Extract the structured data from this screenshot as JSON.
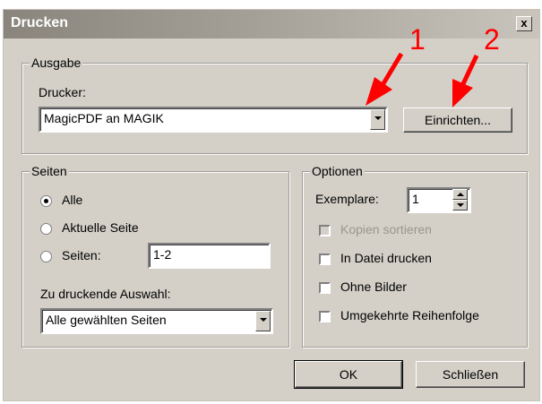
{
  "window": {
    "title": "Drucken",
    "close_label": "x"
  },
  "output_group": {
    "legend": "Ausgabe",
    "printer_label": "Drucker:",
    "printer_value": "MagicPDF an MAGIK",
    "setup_button": "Einrichten..."
  },
  "pages_group": {
    "legend": "Seiten",
    "options": [
      {
        "label": "Alle",
        "selected": true
      },
      {
        "label": "Aktuelle Seite",
        "selected": false
      },
      {
        "label": "Seiten:",
        "selected": false
      }
    ],
    "pages_value": "1-2",
    "selection_label": "Zu druckende Auswahl:",
    "selection_value": "Alle gewählten Seiten"
  },
  "options_group": {
    "legend": "Optionen",
    "copies_label": "Exemplare:",
    "copies_value": "1",
    "checkboxes": [
      {
        "label": "Kopien sortieren",
        "checked": false,
        "enabled": false
      },
      {
        "label": "In Datei drucken",
        "checked": false,
        "enabled": true
      },
      {
        "label": "Ohne Bilder",
        "checked": false,
        "enabled": true
      },
      {
        "label": "Umgekehrte Reihenfolge",
        "checked": false,
        "enabled": true
      }
    ]
  },
  "buttons": {
    "ok": "OK",
    "close": "Schließen"
  },
  "annotations": {
    "label_1": "1",
    "label_2": "2",
    "color": "#ff0000"
  }
}
